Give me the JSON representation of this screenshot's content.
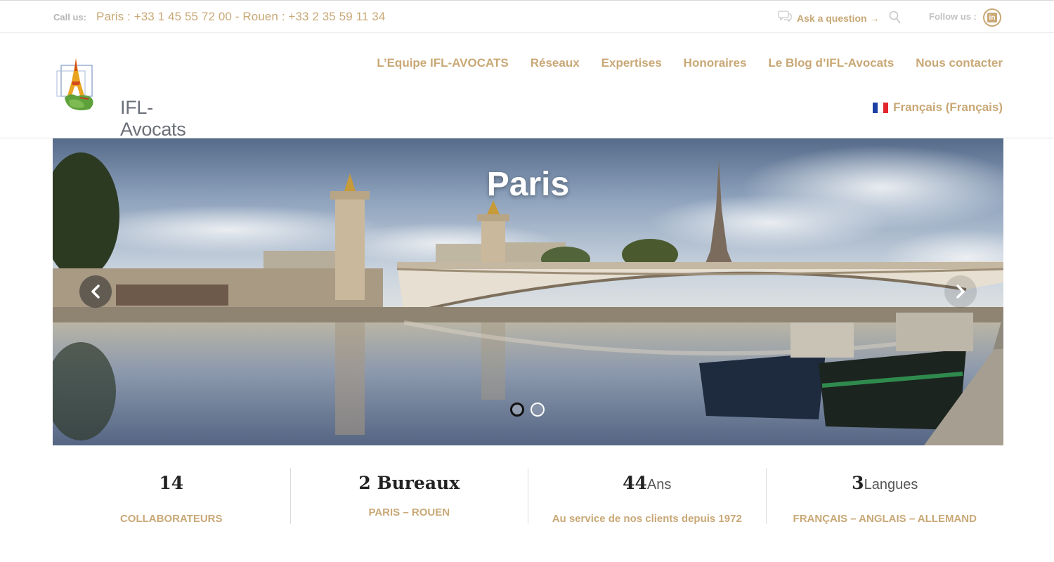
{
  "topbar": {
    "call_label": "Call us:",
    "phones": "Paris : +33 1 45 55 72 00 - Rouen : +33 2 35 59 11 34",
    "ask_label": "Ask a question →",
    "follow_label": "Follow us :",
    "icons": [
      "speech-bubble-icon",
      "search-icon",
      "linkedin-icon"
    ]
  },
  "logo": {
    "text": "IFL-Avocats"
  },
  "nav": {
    "items": [
      {
        "label": "L’Equipe IFL-AVOCATS"
      },
      {
        "label": "Réseaux"
      },
      {
        "label": "Expertises"
      },
      {
        "label": "Honoraires"
      },
      {
        "label": "Le Blog d’IFL-Avocats"
      },
      {
        "label": "Nous contacter"
      }
    ],
    "language": "Français (Français)"
  },
  "slider": {
    "title": "Paris",
    "slide_count": 2,
    "active_slide": 1,
    "icons": [
      "chevron-left-icon",
      "chevron-right-icon"
    ]
  },
  "stats": [
    {
      "number": "14",
      "unit": "",
      "subtitle": "COLLABORATEURS"
    },
    {
      "number": "2 Bureaux",
      "unit": "",
      "subtitle": "PARIS – ROUEN"
    },
    {
      "number": "44",
      "unit": "Ans",
      "subtitle": "Au service de nos clients depuis 1972"
    },
    {
      "number": "3",
      "unit": "Langues",
      "subtitle": "FRANÇAIS – ANGLAIS – ALLEMAND"
    }
  ],
  "colors": {
    "accent": "#c9a876",
    "text_dark": "#222222",
    "muted": "#b5b5b5"
  }
}
